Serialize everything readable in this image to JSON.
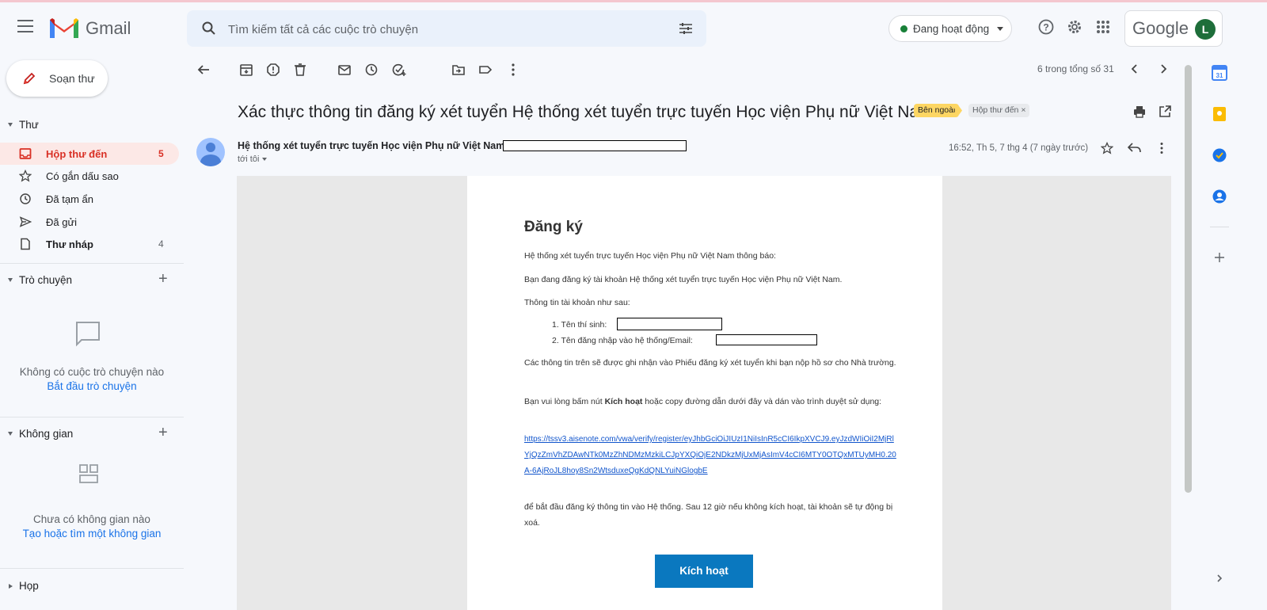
{
  "app": {
    "name": "Gmail"
  },
  "search": {
    "placeholder": "Tìm kiếm tất cả các cuộc trò chuyện"
  },
  "status": {
    "label": "Đang hoạt động",
    "color": "#188038"
  },
  "account": {
    "brand": "Google",
    "avatar_letter": "L"
  },
  "sidebar": {
    "compose": "Soạn thư",
    "mail_section": "Thư",
    "items": [
      {
        "label": "Hộp thư đến",
        "count": "5",
        "icon": "inbox-icon"
      },
      {
        "label": "Có gắn dấu sao",
        "count": "",
        "icon": "star-icon"
      },
      {
        "label": "Đã tạm ẩn",
        "count": "",
        "icon": "clock-icon"
      },
      {
        "label": "Đã gửi",
        "count": "",
        "icon": "send-icon"
      },
      {
        "label": "Thư nháp",
        "count": "4",
        "icon": "draft-icon"
      }
    ],
    "chat_section": "Trò chuyện",
    "chat_empty": "Không có cuộc trò chuyện nào",
    "chat_start": "Bắt đầu trò chuyện",
    "spaces_section": "Không gian",
    "spaces_empty": "Chưa có không gian nào",
    "spaces_create": "Tạo hoặc tìm một không gian",
    "meet_section": "Họp"
  },
  "toolbar": {
    "pager": "6 trong tổng số 31"
  },
  "email": {
    "subject": "Xác thực thông tin đăng ký xét tuyển Hệ thống xét tuyển trực tuyến Học viện Phụ nữ Việt Nam",
    "label_external": "Bên ngoài",
    "label_inbox": "Hộp thư đến ×",
    "sender": "Hệ thống xét tuyển trực tuyến Học viện Phụ nữ Việt Nam",
    "to": "tới tôi",
    "date": "16:52, Th 5, 7 thg 4 (7 ngày trước)",
    "body": {
      "heading": "Đăng ký",
      "p1": "Hệ thống xét tuyển trực tuyến Học viện Phụ nữ Việt Nam thông báo:",
      "p2": "Bạn đang đăng ký tài khoản Hệ thống xét tuyển trực tuyến Học viện Phụ nữ Việt Nam.",
      "p3": "Thông tin tài khoản như sau:",
      "li1": "1. Tên thí sinh:",
      "li2": "2. Tên đăng nhập vào hệ thống/Email:",
      "p4": "Các thông tin trên sẽ được ghi nhận vào Phiếu đăng ký xét tuyển khi bạn nộp hồ sơ cho Nhà trường.",
      "p5_a": "Bạn vui lòng bấm nút ",
      "p5_b": "Kích hoạt",
      "p5_c": " hoặc copy đường dẫn dưới đây và dán vào trình duyệt sử dụng:",
      "link": "https://tssv3.aisenote.com/vwa/verify/register/eyJhbGciOiJIUzI1NiIsInR5cCI6IkpXVCJ9.eyJzdWIiOiI2MjRlYjQzZmVhZDAwNTk0MzZhNDMzMzkiLCJpYXQiOjE2NDkzMjUxMjAsImV4cCI6MTY0OTQxMTUyMH0.20A-6AjRoJL8hoy8Sn2WtsduxeQgKdQNLYuiNGlogbE",
      "p6": "để bắt đầu đăng ký thông tin vào Hệ thống. Sau 12 giờ nếu không kích hoạt, tài khoản sẽ tự động bị xoá.",
      "button": "Kích hoạt"
    }
  }
}
